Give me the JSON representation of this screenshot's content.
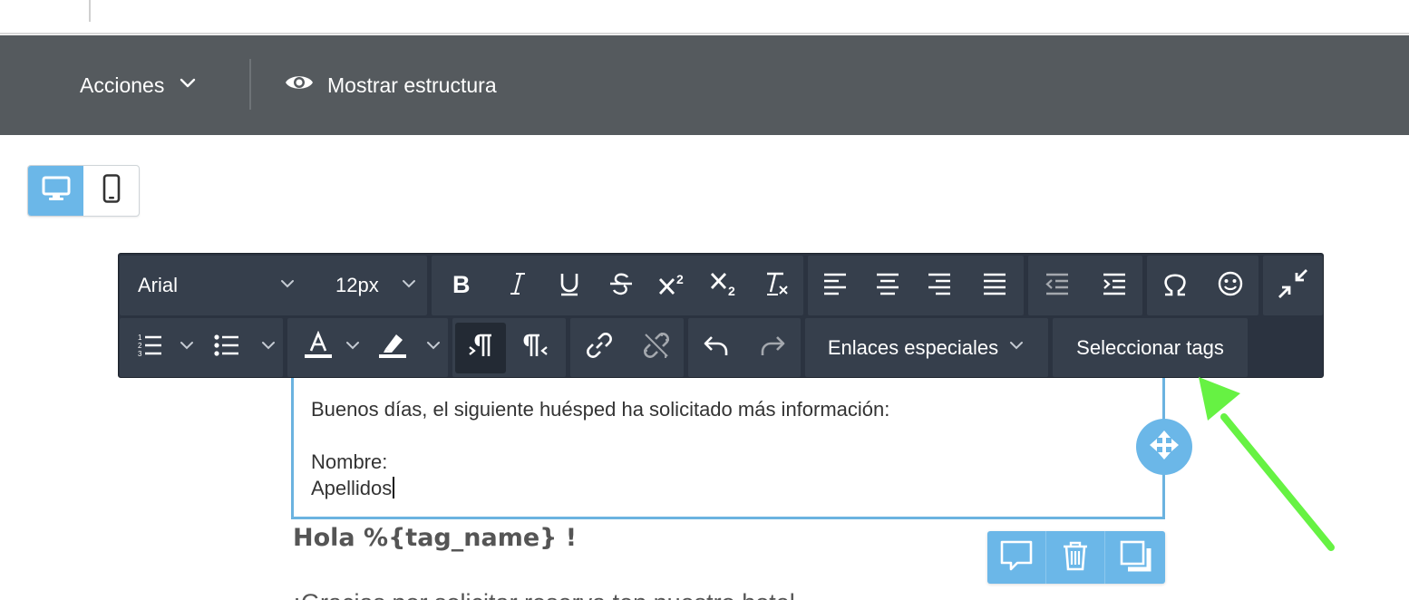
{
  "actionbar": {
    "actions_label": "Acciones",
    "structure_label": "Mostrar estructura"
  },
  "devices": {
    "desktop_icon": "monitor-icon",
    "mobile_icon": "smartphone-icon",
    "active": "desktop"
  },
  "toolbar": {
    "font_family": "Arial",
    "font_size": "12px",
    "special_links_label": "Enlaces especiales",
    "select_tags_label": "Seleccionar tags"
  },
  "editor": {
    "line1": "Buenos días, el siguiente huésped ha solicitado más información:",
    "line2": "Nombre:",
    "line3": "Apellidos"
  },
  "content": {
    "greeting": "Hola %{tag_name} !",
    "partial_line": "¡Gracias por solicitar reserva ten nuestro hotel..."
  },
  "colors": {
    "accent": "#6bb7e8",
    "actionbar": "#555a5e",
    "toolbar": "#2b3340",
    "annotation_arrow": "#66f243"
  }
}
